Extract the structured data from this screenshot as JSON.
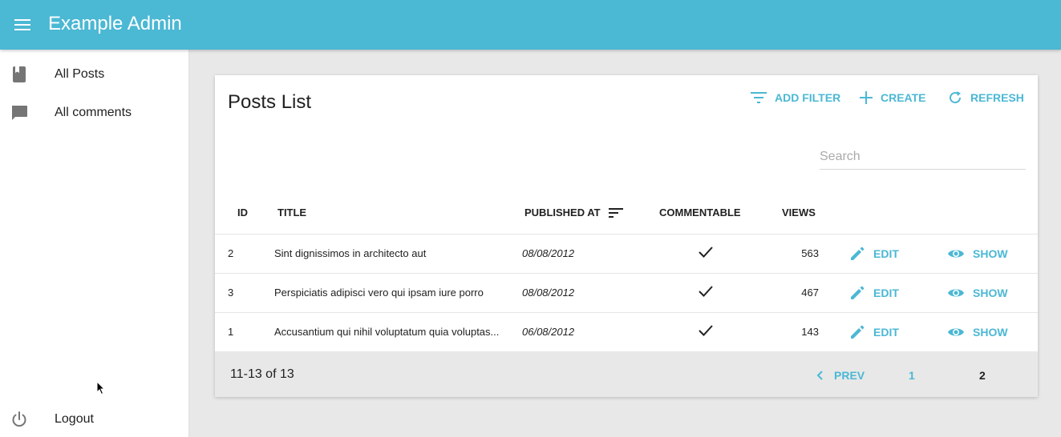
{
  "app": {
    "title": "Example Admin"
  },
  "sidebar": {
    "items": [
      {
        "label": "All Posts",
        "icon": "book-icon"
      },
      {
        "label": "All comments",
        "icon": "comment-icon"
      }
    ],
    "logout": {
      "label": "Logout",
      "icon": "power-icon"
    }
  },
  "list": {
    "title": "Posts List",
    "actions": {
      "add_filter": "ADD FILTER",
      "create": "CREATE",
      "refresh": "REFRESH"
    },
    "search_placeholder": "Search",
    "columns": {
      "id": "ID",
      "title": "TITLE",
      "published_at": "PUBLISHED AT",
      "commentable": "COMMENTABLE",
      "views": "VIEWS"
    },
    "rows": [
      {
        "id": "2",
        "title": "Sint dignissimos in architecto aut",
        "published_at": "08/08/2012",
        "commentable": true,
        "views": "563"
      },
      {
        "id": "3",
        "title": "Perspiciatis adipisci vero qui ipsam iure porro",
        "published_at": "08/08/2012",
        "commentable": true,
        "views": "467"
      },
      {
        "id": "1",
        "title": "Accusantium qui nihil voluptatum quia voluptas...",
        "published_at": "06/08/2012",
        "commentable": true,
        "views": "143"
      }
    ],
    "row_actions": {
      "edit": "EDIT",
      "show": "SHOW"
    },
    "pagination": {
      "range": "11-13 of 13",
      "prev": "PREV",
      "pages": [
        "1",
        "2"
      ],
      "current_page": "2"
    }
  },
  "colors": {
    "primary": "#4bb8d4",
    "background": "#e8e8e8"
  }
}
